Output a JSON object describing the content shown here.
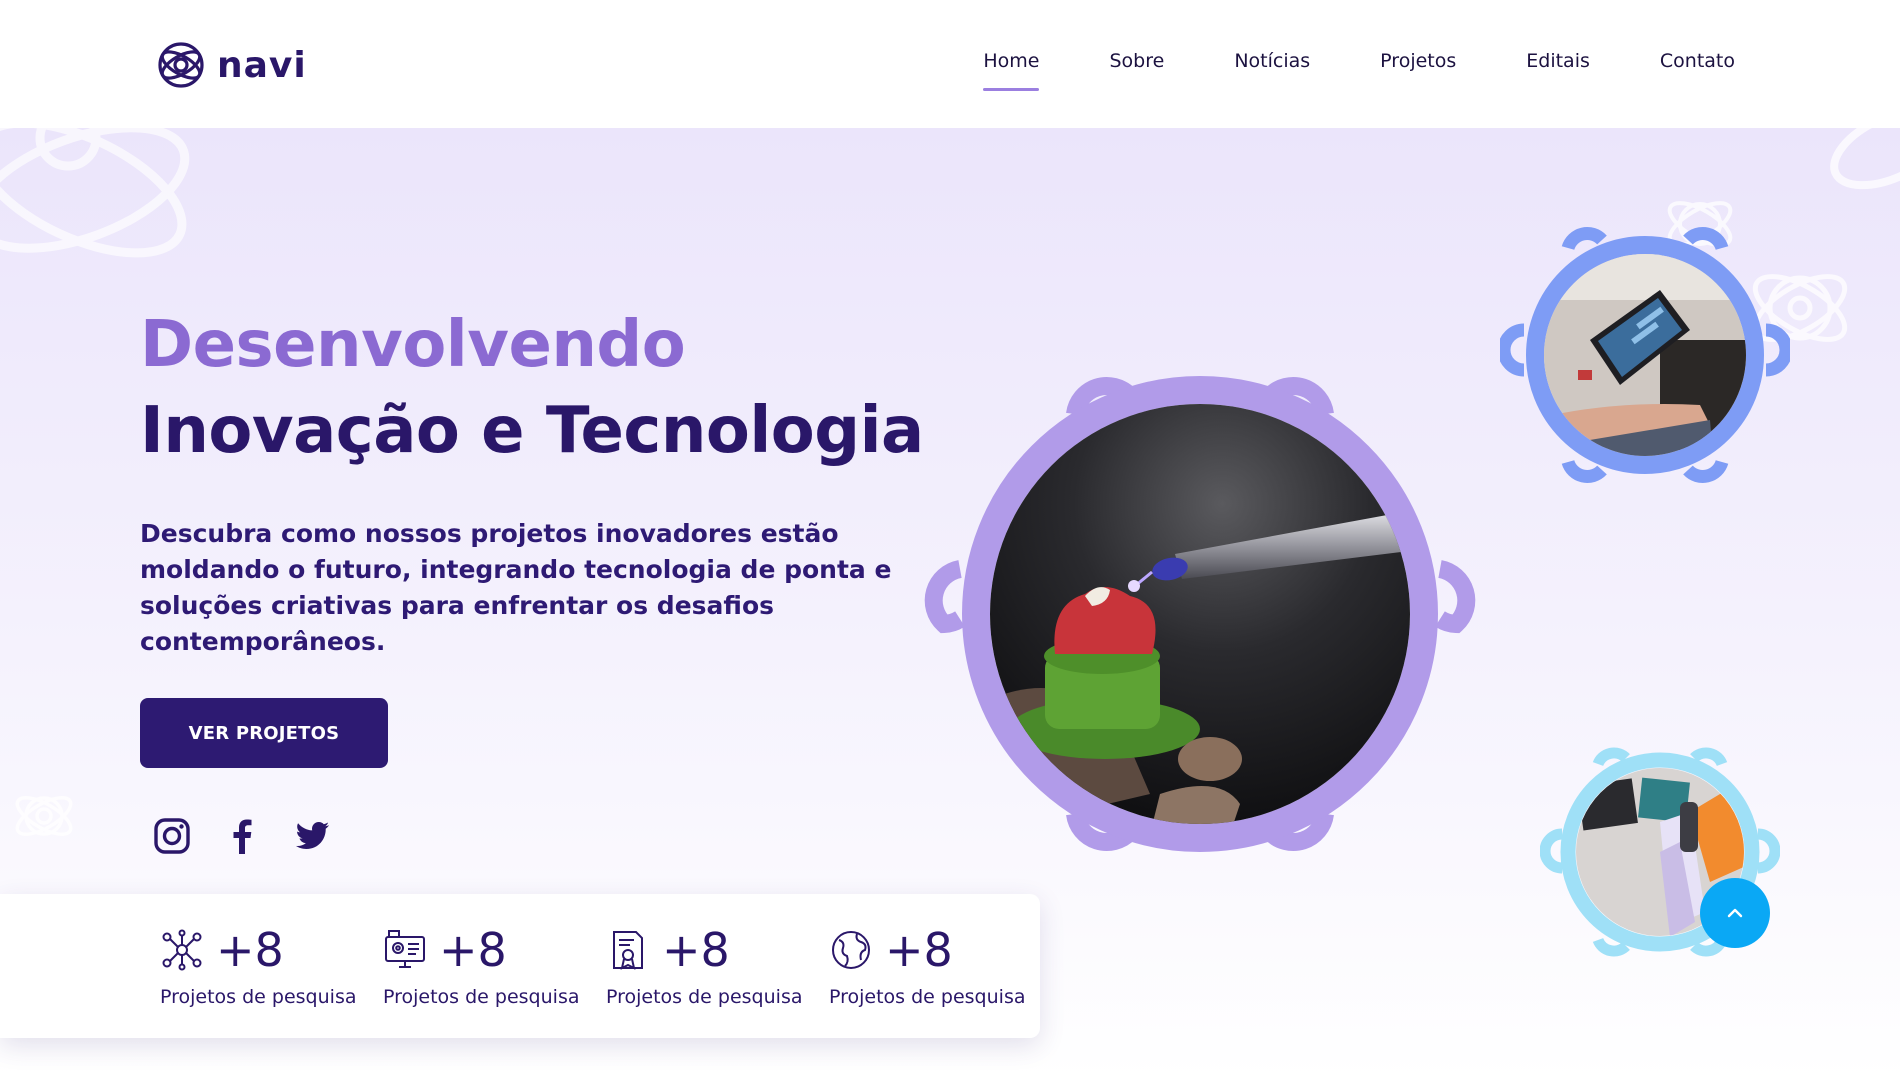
{
  "header": {
    "logo_text": "navi",
    "nav": [
      {
        "label": "Home",
        "active": true
      },
      {
        "label": "Sobre",
        "active": false
      },
      {
        "label": "Notícias",
        "active": false
      },
      {
        "label": "Projetos",
        "active": false
      },
      {
        "label": "Editais",
        "active": false
      },
      {
        "label": "Contato",
        "active": false
      }
    ]
  },
  "hero": {
    "headline_line1": "Desenvolvendo",
    "headline_line2": "Inovação e Tecnologia",
    "lead": "Descubra como nossos projetos inovadores estão moldando o futuro, integrando tecnologia de ponta e soluções criativas para enfrentar os desafios contemporâneos.",
    "cta_label": "VER PROJETOS"
  },
  "socials": [
    {
      "name": "instagram-icon"
    },
    {
      "name": "facebook-icon"
    },
    {
      "name": "twitter-icon"
    }
  ],
  "stats": [
    {
      "icon": "network-icon",
      "value": "+8",
      "label": "Projetos de pesquisa"
    },
    {
      "icon": "monitor-gear-icon",
      "value": "+8",
      "label": "Projetos de pesquisa"
    },
    {
      "icon": "document-award-icon",
      "value": "+8",
      "label": "Projetos de pesquisa"
    },
    {
      "icon": "globe-icon",
      "value": "+8",
      "label": "Projetos de pesquisa"
    }
  ],
  "colors": {
    "brand_dark": "#2a1769",
    "brand_light": "#8b6ad2",
    "ring_purple": "#b19be9",
    "ring_blue": "#7e9cf5",
    "ring_cyan": "#9fe0f7",
    "scroll_button": "#0aa8f5"
  }
}
